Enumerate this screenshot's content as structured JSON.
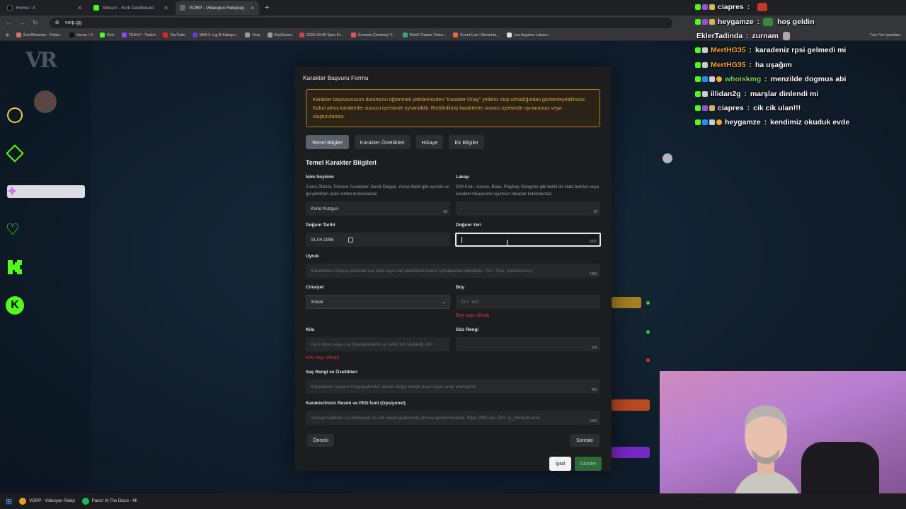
{
  "browser": {
    "tabs": [
      {
        "label": "Home / X",
        "color": "#111111"
      },
      {
        "label": "Stream - Kick Dashboard",
        "color": "#53fc18"
      },
      {
        "label": "VORP - Videoyun Roleplay",
        "color": "#2b2b2b"
      }
    ],
    "url": "vorp.gg",
    "bookmarks": [
      "Son Mimarlar - Patici...",
      "Home / X",
      "Kick",
      "TEASY - Twitch",
      "YouTube",
      "NBA 3. Lig B Katego...",
      "Vorp",
      "KeyGivers",
      "2025-09-06 Spor Et...",
      "Ücretsiz Çevrimiçi Y...",
      "WoW Classic Talen...",
      "Event List / Streamla...",
      "Los Angeles Lakers..."
    ],
    "bookmarks_right": "Tüm Yer İşaretleri"
  },
  "modal": {
    "title": "Karakter Başvuru Formu",
    "alert": "Karakter başvurunuzun durumunu öğrenmek yetkilerinizden \"Karakter Onay\" yetkiniz olup olmadığından gözlemleyebilirsiniz. Kabul almış karakterler sunucu içerisinde oynanabilir. Reddedilmiş karakterler sunucu içerisinde oynanamaz veya oluşturulamaz.",
    "tabs": [
      "Temel Bilgiler",
      "Karakter Özellikleri",
      "Hikaye",
      "Ek Bilgiler"
    ],
    "section_title": "Temel Karakter Bilgileri",
    "fields": {
      "name": {
        "label": "İsim Soyisim",
        "help": "Zurna Öttürür, Tencere Yuvarlanır, Deniz Dalgalı, Yunus Balık gibi uyumlu ve gerçeklikten uzak isimler kullanılamaz.",
        "value": "Koral Kuzgun",
        "count": "88"
      },
      "nickname": {
        "label": "Lakap",
        "help": "Drift Kralı, Vurucu, Baba, Playboy, Gangster gibi belirli bir statü belirten veya karakter hikayesine uyumsuz lakaplar kullanılamaz.",
        "value": "-",
        "count": "99"
      },
      "birthdate": {
        "label": "Doğum Tarihi",
        "value": "01.04.1996"
      },
      "birthplace": {
        "label": "Doğum Yeri",
        "value": "",
        "count": "1000"
      },
      "nationality": {
        "label": "Uyruk",
        "placeholder": "Karakterler Dünya üzerinde var olan veya var olabilecek bütün uyruklardan olabilirler. Örn: Türk, Amerikan vs.",
        "count": "1000"
      },
      "gender": {
        "label": "Cinsiyet",
        "value": "Erkek"
      },
      "height": {
        "label": "Boy",
        "placeholder": "Örn: 180",
        "error": "Boy sayı olmalı"
      },
      "weight": {
        "label": "Kilo",
        "placeholder": "Aşırı kilolu veya zayıf karakterlerin ve belirli bir hastalığı olm",
        "error": "Kilo sayı olmalı"
      },
      "eye_color": {
        "label": "Göz Rengi",
        "value": "",
        "count": "100"
      },
      "hair": {
        "label": "Saç Rengi ve Özellikleri",
        "placeholder": "Karakterler saçlarını boyayabilirler ancak doğal olarak mavi saça sahip olamazlar.",
        "count": "200"
      },
      "ped": {
        "label": "Karakterinizin Resmi ve PED İsmi (Opsiyonel)",
        "placeholder": "Yüksek kalitede ve hizlinesim vb. bir siteye yüklenmiş olması gerekmektedir. Eğer PED ise: Örn: ig_jimmydisanto",
        "count": "1000"
      }
    },
    "prev_label": "Önceki",
    "next_label": "Sonraki",
    "cancel_label": "İptal",
    "submit_label": "Gönder"
  },
  "chat": [
    {
      "user": "ciapres",
      "msg": "",
      "color": "#ffffff",
      "emote": "#c0392b"
    },
    {
      "user": "heygamze",
      "msg": "hoş geldin",
      "color": "#ffffff",
      "emote": "#3a8a3a"
    },
    {
      "user": "EklerTadinda",
      "msg": "zurnam",
      "color": "#ffffff",
      "emote": ""
    },
    {
      "user": "MertHG35",
      "msg": "karadeniz rpsi gelmedi mi",
      "color": "#f5a623",
      "emote": ""
    },
    {
      "user": "MertHG35",
      "msg": "ha uşağım",
      "color": "#f5a623",
      "emote": ""
    },
    {
      "user": "whoiskmg",
      "msg": "menzilde dogmus abi",
      "color": "#7dd35a",
      "emote": ""
    },
    {
      "user": "illidan2g",
      "msg": "marşlar dinlendi mi",
      "color": "#ffffff",
      "emote": ""
    },
    {
      "user": "ciapres",
      "msg": "cik cik ulan!!!",
      "color": "#ffffff",
      "emote": ""
    },
    {
      "user": "heygamze",
      "msg": "kendimiz okuduk evde",
      "color": "#ffffff",
      "emote": ""
    }
  ],
  "taskbar": {
    "items": [
      "VORP - Videoyun Rolep",
      "Panic! At The Disco - Mi"
    ]
  }
}
